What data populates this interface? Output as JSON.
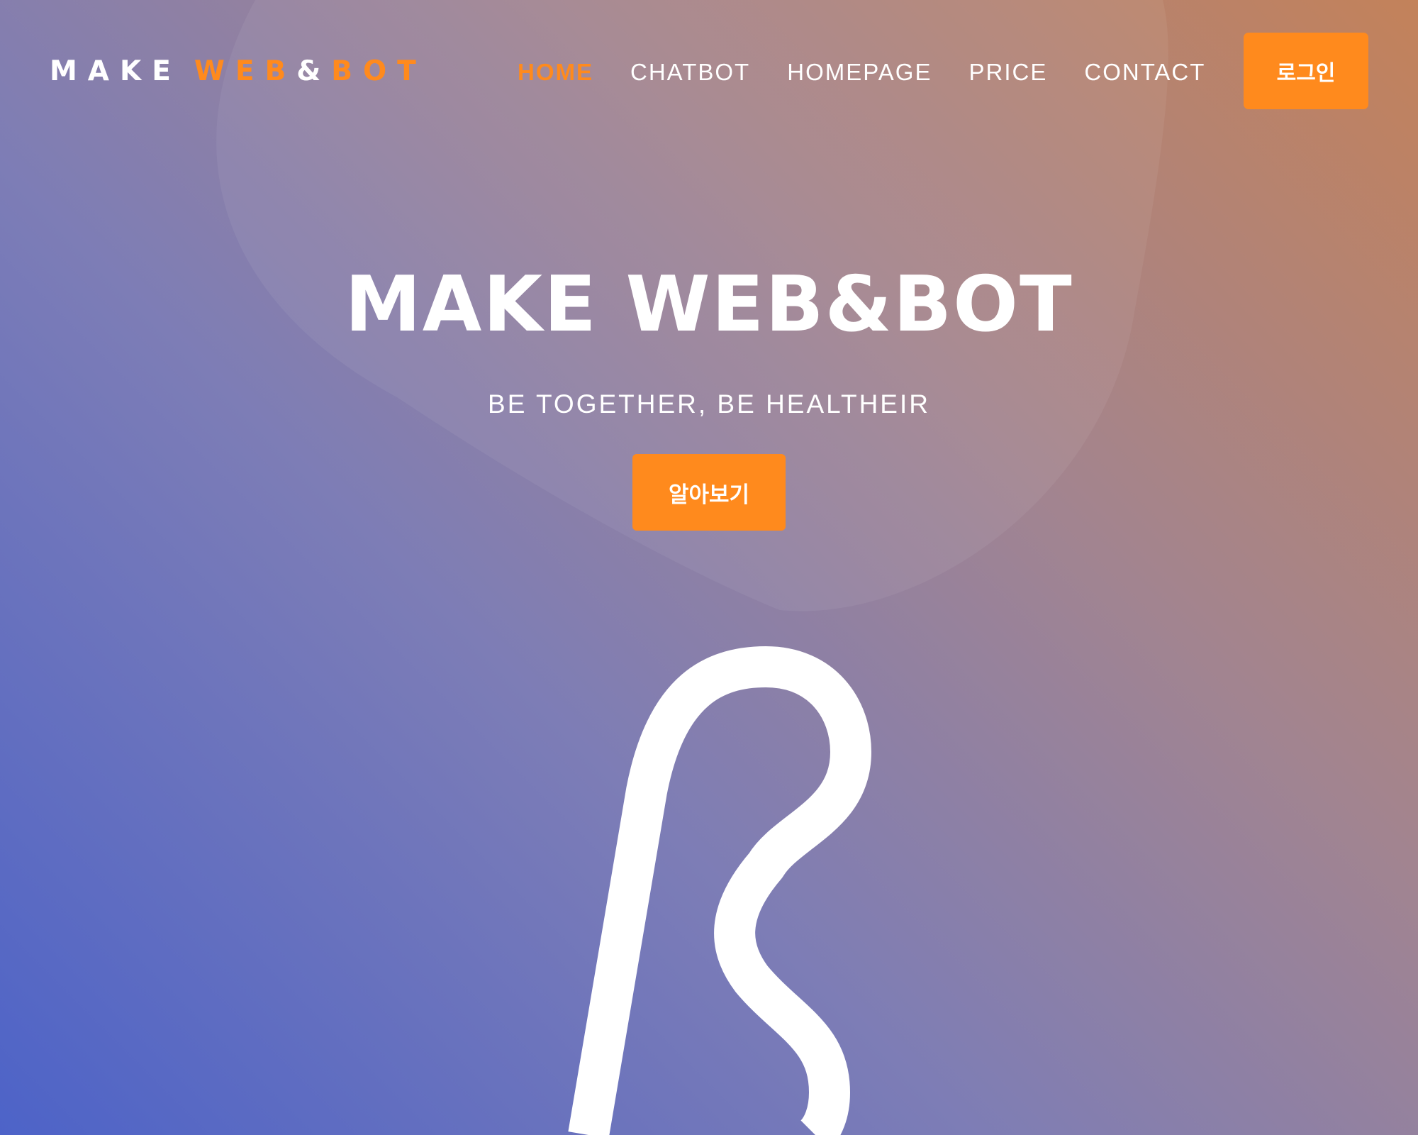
{
  "colors": {
    "accent": "#ff8a1d",
    "text": "#ffffff",
    "gradient_start": "#4d63c8",
    "gradient_end": "#c3825a"
  },
  "navbar": {
    "logo": {
      "part1": "MAKE",
      "part2": "WEB",
      "part3": "&",
      "part4": "BOT"
    },
    "links": [
      {
        "label": "HOME",
        "active": true
      },
      {
        "label": "CHATBOT",
        "active": false
      },
      {
        "label": "HOMEPAGE",
        "active": false
      },
      {
        "label": "PRICE",
        "active": false
      },
      {
        "label": "CONTACT",
        "active": false
      }
    ],
    "login_label": "로그인"
  },
  "hero": {
    "title": "MAKE WEB&BOT",
    "subtitle": "BE TOGETHER, BE HEALTHEIR",
    "cta_label": "알아보기"
  },
  "decor": {
    "brand_mark_icon": "script-b-logo-icon",
    "blob": "background-blob-shape"
  }
}
